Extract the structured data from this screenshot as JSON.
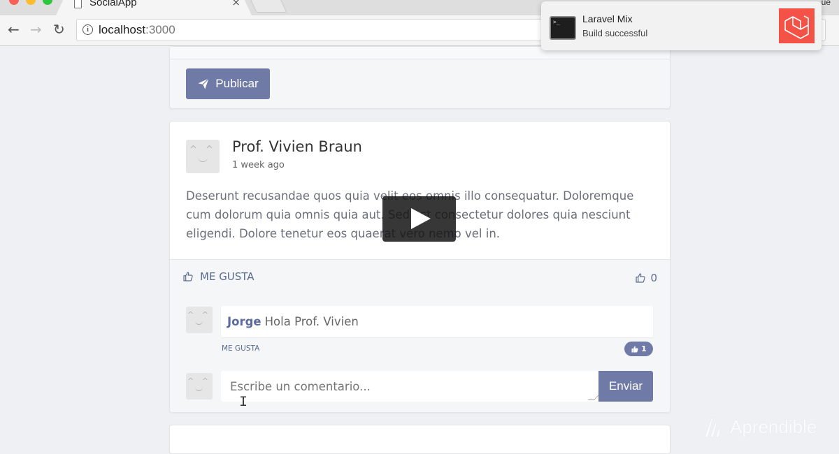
{
  "browser": {
    "tab_title": "SocialApp",
    "close_glyph": "×",
    "corner_text": "ue",
    "url_host": "localhost",
    "url_port": ":3000"
  },
  "publish": {
    "button_label": "Publicar"
  },
  "post": {
    "author": "Prof. Vivien Braun",
    "time": "1 week ago",
    "body": "Deserunt recusandae quos quia velit eos omnis illo consequatur. Doloremque cum dolorum quia omnis quia aut. Sed est consectetur dolores quia nesciunt eligendi. Dolore tenetur eos quaerat vero nemo vel in.",
    "like_label": "ME GUSTA",
    "like_count": "0"
  },
  "comment": {
    "author": "Jorge",
    "text": "Hola Prof. Vivien",
    "like_label": "ME GUSTA",
    "like_count": "1"
  },
  "comment_form": {
    "placeholder": "Escribe un comentario...",
    "submit_label": "Enviar"
  },
  "notification": {
    "title": "Laravel Mix",
    "body": "Build successful"
  },
  "watermark": {
    "text": "Aprendible"
  },
  "colors": {
    "accent": "#6f7ba6",
    "link": "#5b6b8f",
    "laravel": "#f55247"
  }
}
